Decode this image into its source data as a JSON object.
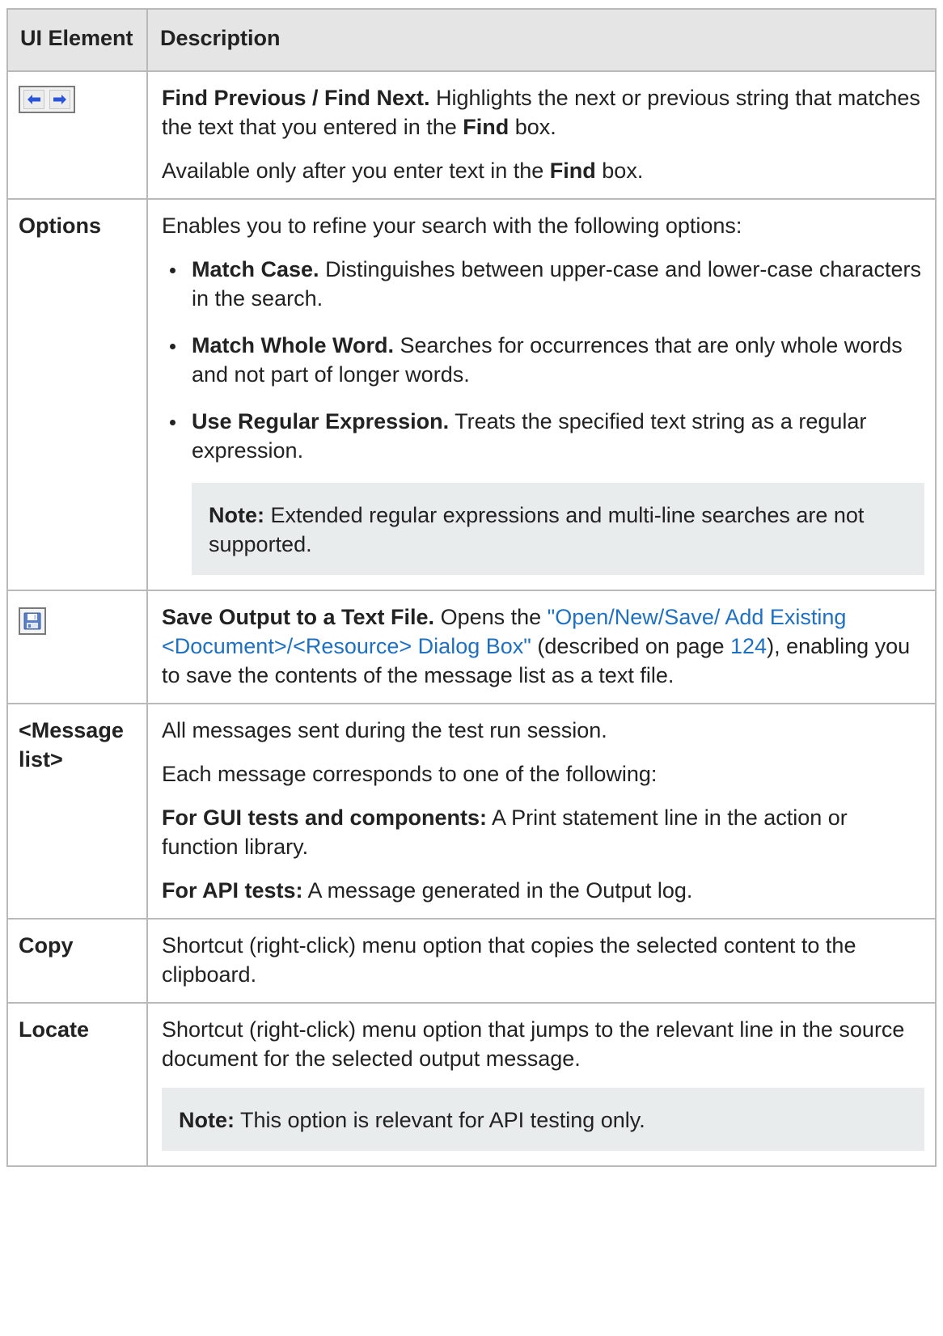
{
  "header": {
    "col1": "UI Element",
    "col2": "Description"
  },
  "rows": {
    "find": {
      "icon": "arrow-left-right-icons",
      "title": "Find Previous / Find Next.",
      "text1": " Highlights the next or previous string that matches the text that you entered in the ",
      "bold_find": "Find",
      "text2": " box.",
      "avail_pre": "Available only after you enter text in the ",
      "avail_bold": "Find",
      "avail_post": " box."
    },
    "options": {
      "label": "Options",
      "intro": "Enables you to refine your search with the following options:",
      "items": [
        {
          "title": "Match Case.",
          "text": " Distinguishes between upper-case and lower-case characters in the search."
        },
        {
          "title": "Match Whole Word.",
          "text": " Searches for occurrences that are only whole words and not part of longer words."
        },
        {
          "title": "Use Regular Expression.",
          "text": " Treats the specified text string as a regular expression."
        }
      ],
      "note_label": "Note:",
      "note_text": " Extended regular expressions and multi-line searches are not supported."
    },
    "save": {
      "icon": "floppy-disk-icon",
      "title": "Save Output to a Text File.",
      "text1": " Opens the ",
      "link": "\"Open/New/Save/ Add Existing <Document>/<Resource> Dialog Box\"",
      "text2": " (described on page ",
      "page_link": "124",
      "text3": "), enabling you to save the contents of the message list as a text file."
    },
    "message_list": {
      "label": "<Message list>",
      "p1": "All messages sent during the test run session.",
      "p2": "Each message corresponds to one of the following:",
      "gui_bold": "For GUI tests and components:",
      "gui_text": " A Print statement line in the action or function library.",
      "api_bold": "For API tests:",
      "api_text": " A message generated in the Output log."
    },
    "copy": {
      "label": "Copy",
      "text": "Shortcut (right-click) menu option that copies the selected content to the clipboard."
    },
    "locate": {
      "label": "Locate",
      "text": "Shortcut (right-click) menu option that jumps to the relevant line in the source document for the selected output message.",
      "note_label": "Note:",
      "note_text": " This option is relevant for API testing only."
    }
  },
  "colors": {
    "header_bg": "#e5e5e5",
    "border": "#b9b9b9",
    "note_bg": "#e8ecec",
    "link": "#1f70c1",
    "arrow": "#2b55d8"
  }
}
